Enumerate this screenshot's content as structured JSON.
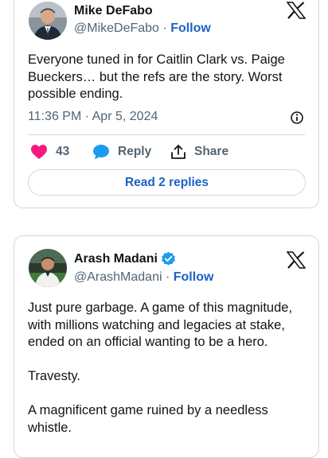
{
  "tweets": [
    {
      "author": "Mike DeFabo",
      "handle": "@MikeDeFabo",
      "separator": "·",
      "follow": "Follow",
      "text": "Everyone tuned in for Caitlin Clark vs. Paige Bueckers… but the refs are the story. Worst possible ending.",
      "timestamp": "11:36 PM · Apr 5, 2024",
      "likes": "43",
      "reply_label": "Reply",
      "share_label": "Share",
      "read_replies": "Read 2 replies"
    },
    {
      "author": "Arash Madani",
      "handle": "@ArashMadani",
      "separator": "·",
      "follow": "Follow",
      "verified": true,
      "paragraphs": [
        "Just pure garbage. A game of this magnitude, with millions watching and legacies at stake, ended on an official wanting to be a hero.",
        "Travesty.",
        "A magnificent game ruined by a needless whistle."
      ]
    }
  ],
  "colors": {
    "like": "#f91880",
    "reply": "#1d9bf0",
    "link": "#1d62c5",
    "secondary_text": "#536471",
    "border": "#cfd9de"
  },
  "icons": [
    "x-logo-icon",
    "heart-icon",
    "speech-bubble-icon",
    "share-icon",
    "info-icon",
    "verified-badge-icon"
  ]
}
